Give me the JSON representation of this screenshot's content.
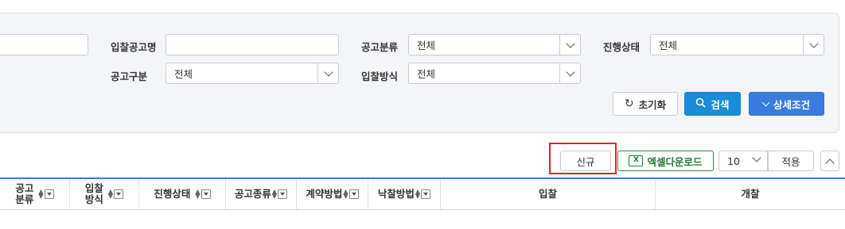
{
  "search": {
    "fields": {
      "keyword_input_value": "",
      "bid_name_label": "입찰공고명",
      "bid_name_value": "",
      "notice_category_label": "공고분류",
      "notice_category_value": "전체",
      "progress_status_label": "진행상태",
      "progress_status_value": "전체",
      "notice_type_label": "공고구분",
      "notice_type_value": "전체",
      "bid_method_label": "입찰방식",
      "bid_method_value": "전체"
    },
    "buttons": {
      "reset_label": "초기화",
      "search_label": "검색",
      "detail_label": "상세조건"
    }
  },
  "toolbar": {
    "new_label": "신규",
    "excel_label": "엑셀다운로드",
    "page_size_value": "10",
    "apply_label": "적용"
  },
  "grid": {
    "columns": [
      "공고\n분류",
      "입찰\n방식",
      "진행상태",
      "공고종류",
      "계약방법",
      "낙찰방법",
      "입찰",
      "개찰"
    ]
  },
  "colors": {
    "accent": "#3a7be0",
    "search_button": "#1a8cd8",
    "highlight": "#d9262b",
    "excel_green": "#1f7a3a"
  }
}
